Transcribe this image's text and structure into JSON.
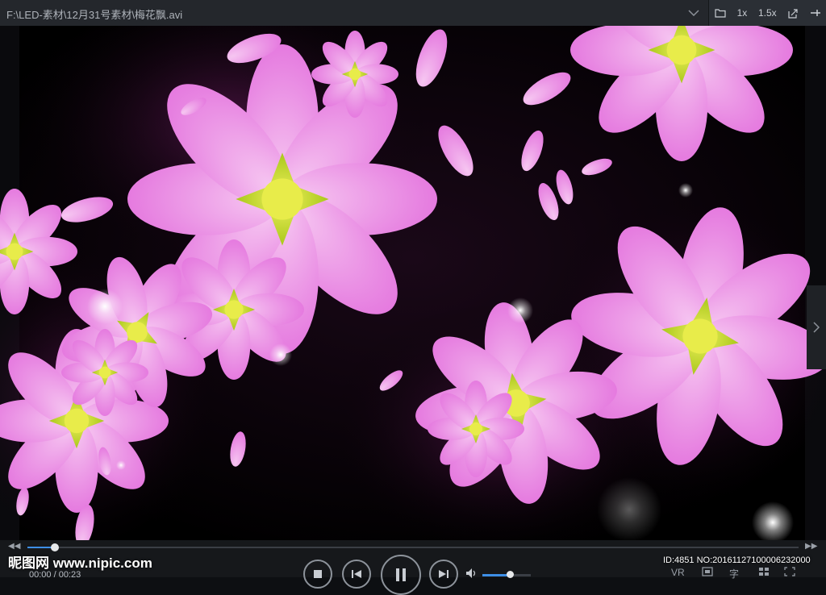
{
  "window": {
    "title_path": "F:\\LED-素材\\12月31号素材\\梅花飘.avi",
    "tools": {
      "folder_icon": "folder-icon",
      "speed_1x": "1x",
      "speed_15x": "1.5x",
      "export_icon": "export-icon",
      "pin_icon": "pin-icon"
    }
  },
  "player": {
    "time_text": "00:00 / 00:23",
    "seek_progress_percent": 3.6,
    "volume_percent": 57,
    "right_labels": {
      "vr": "VR",
      "subtitle": "字"
    }
  },
  "watermark": {
    "site": "昵图网 www.nipic.com",
    "id_text": "ID:4851 NO:20161127100006232000"
  },
  "colors": {
    "accent": "#3d8ee6",
    "petal": "#e77fe0",
    "petal_light": "#f3b1ee",
    "flower_center": "#c9e01a"
  }
}
